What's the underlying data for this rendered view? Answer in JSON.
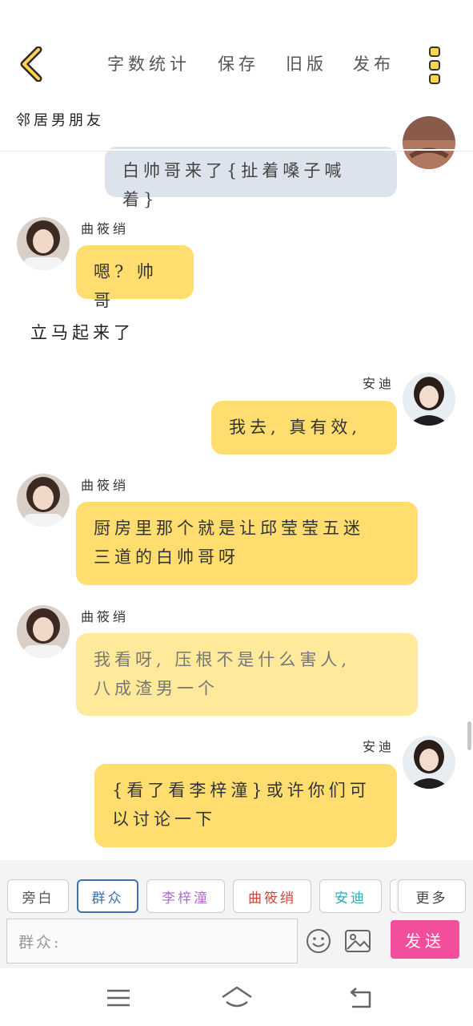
{
  "toolbar": {
    "word_count": "字数统计",
    "save": "保存",
    "old_version": "旧版",
    "publish": "发布"
  },
  "story": {
    "title": "邻居男朋友"
  },
  "messages": {
    "m0": {
      "text": "白帅哥来了{扯着嗓子喊着}"
    },
    "m1": {
      "speaker": "曲筱绡",
      "text": "嗯? 帅哥"
    },
    "narration": {
      "text": "立马起来了"
    },
    "m2": {
      "speaker": "安迪",
      "text": "我去, 真有效,"
    },
    "m3": {
      "speaker": "曲筱绡",
      "line1": "厨房里那个就是让邱莹莹五迷",
      "line2": "三道的白帅哥呀"
    },
    "m4": {
      "speaker": "曲筱绡",
      "line1": "我看呀, 压根不是什么害人,",
      "line2": "八成渣男一个"
    },
    "m5": {
      "speaker": "安迪",
      "line1": "{看了看李梓潼}或许你们可",
      "line2": "以讨论一下"
    }
  },
  "roles": {
    "aside": "旁白",
    "crowd": "群众",
    "li": "李梓潼",
    "qu": "曲筱绡",
    "andi": "安迪",
    "more": "更多"
  },
  "composer": {
    "prefix": "群众:",
    "send": "发送"
  },
  "colors": {
    "accent_yellow": "#ffdd6e",
    "send_pink": "#f24e9b",
    "role_crowd": "#3f6fb5",
    "role_li": "#b06cc9",
    "role_qu": "#d0443a",
    "role_andi": "#2fa9b8"
  }
}
